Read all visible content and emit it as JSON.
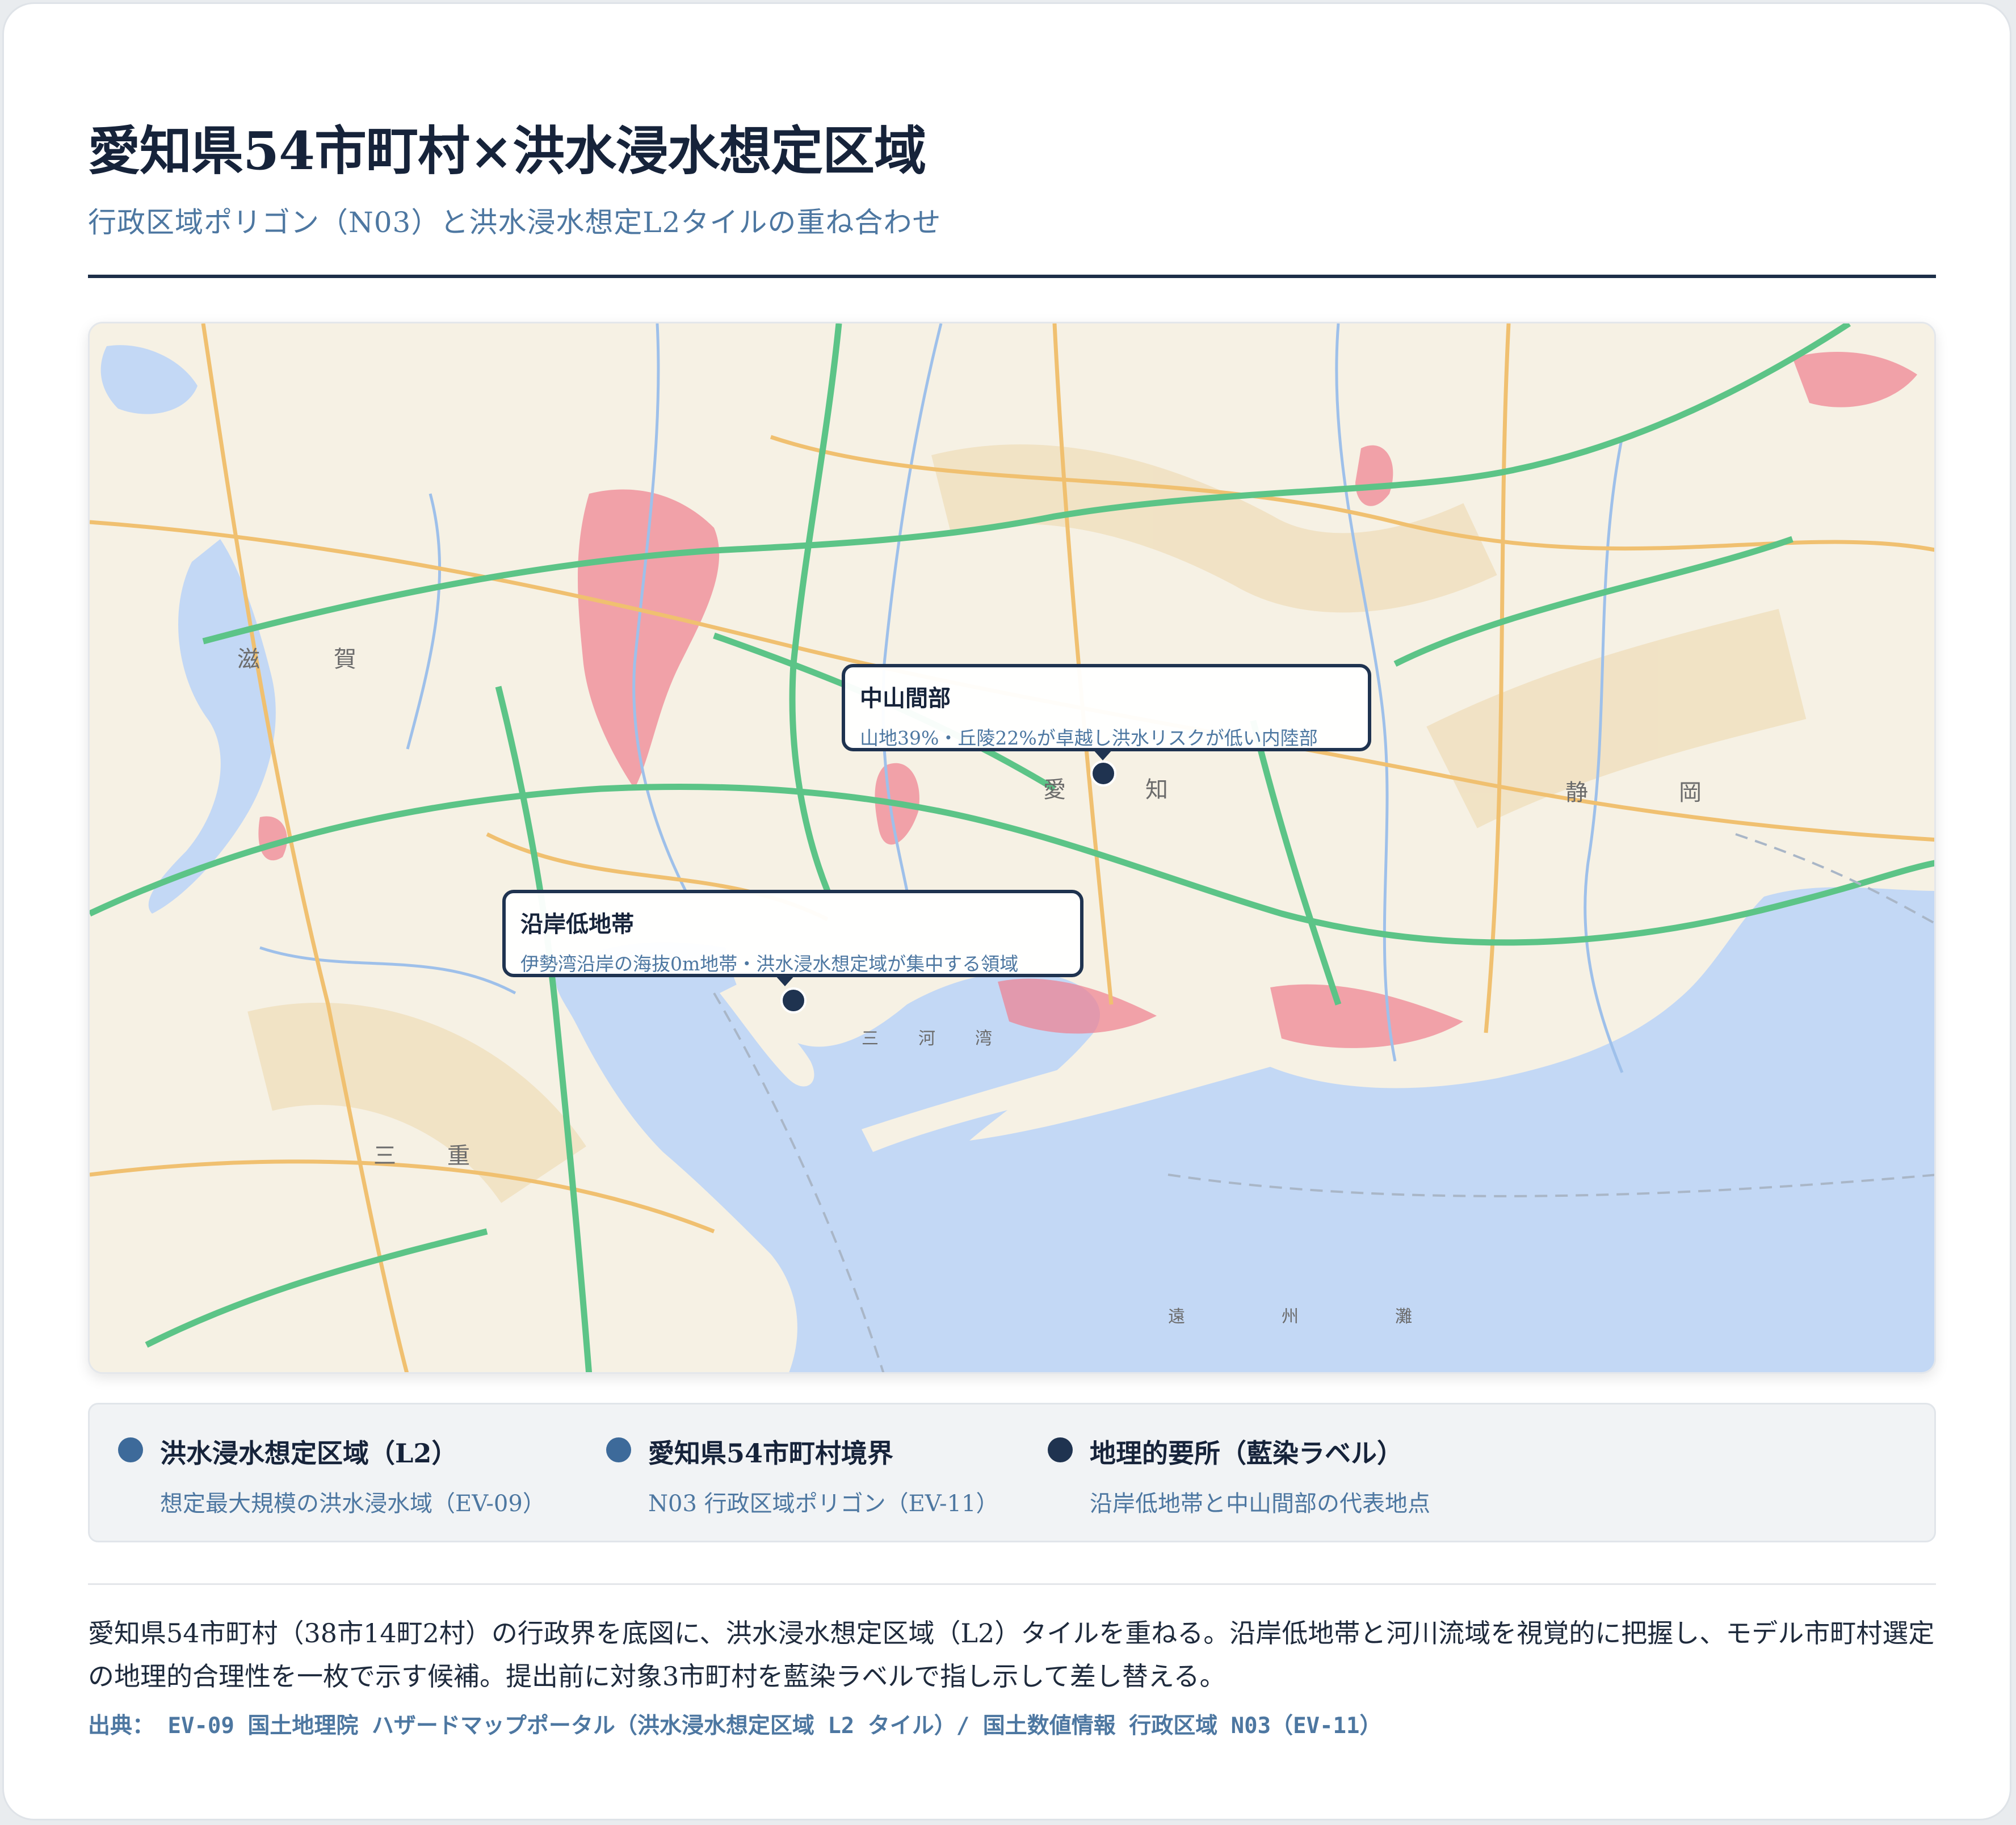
{
  "header": {
    "title": "愛知県54市町村×洪水浸水想定区域",
    "subtitle": "行政区域ポリゴン（N03）と洪水浸水想定L2タイルの重ね合わせ"
  },
  "map": {
    "place_labels": {
      "shiga_left": "滋",
      "shiga_right": "賀",
      "mie_left": "三",
      "mie_right": "重",
      "aichi_left": "愛",
      "aichi_right": "知",
      "shizuoka_left": "静",
      "shizuoka_right": "岡",
      "mikawa_bay_1": "三",
      "mikawa_bay_2": "河",
      "mikawa_bay_3": "湾",
      "enshu_1": "遠",
      "enshu_2": "州",
      "enshu_3": "灘"
    },
    "callouts": {
      "inland": {
        "title": "中山間部",
        "desc": "山地39%・丘陵22%が卓越し洪水リスクが低い内陸部"
      },
      "coastal": {
        "title": "沿岸低地帯",
        "desc": "伊勢湾沿岸の海抜0m地帯・洪水浸水想定域が集中する領域"
      }
    },
    "colors": {
      "sea": "#c3d8f5",
      "land": "#f6f1e4",
      "flood": "#f07f8e",
      "expressway": "#5cc487",
      "road": "#f0c070",
      "river": "#9ec0ea"
    }
  },
  "legend": [
    {
      "name": "洪水浸水想定区域（L2）",
      "desc": "想定最大規模の洪水浸水域（EV-09）",
      "color": "#3d6a9a"
    },
    {
      "name": "愛知県54市町村境界",
      "desc": "N03 行政区域ポリゴン（EV-11）",
      "color": "#3d6a9a"
    },
    {
      "name": "地理的要所（藍染ラベル）",
      "desc": "沿岸低地帯と中山間部の代表地点",
      "color": "#1f3350"
    }
  ],
  "body": {
    "text": "愛知県54市町村（38市14町2村）の行政界を底図に、洪水浸水想定区域（L2）タイルを重ねる。沿岸低地帯と河川流域を視覚的に把握し、モデル市町村選定の地理的合理性を一枚で示す候補。提出前に対象3市町村を藍染ラベルで指し示して差し替える。",
    "source": "出典： EV-09 国土地理院 ハザードマップポータル（洪水浸水想定区域 L2 タイル）/ 国土数値情報 行政区域 N03（EV-11）"
  }
}
